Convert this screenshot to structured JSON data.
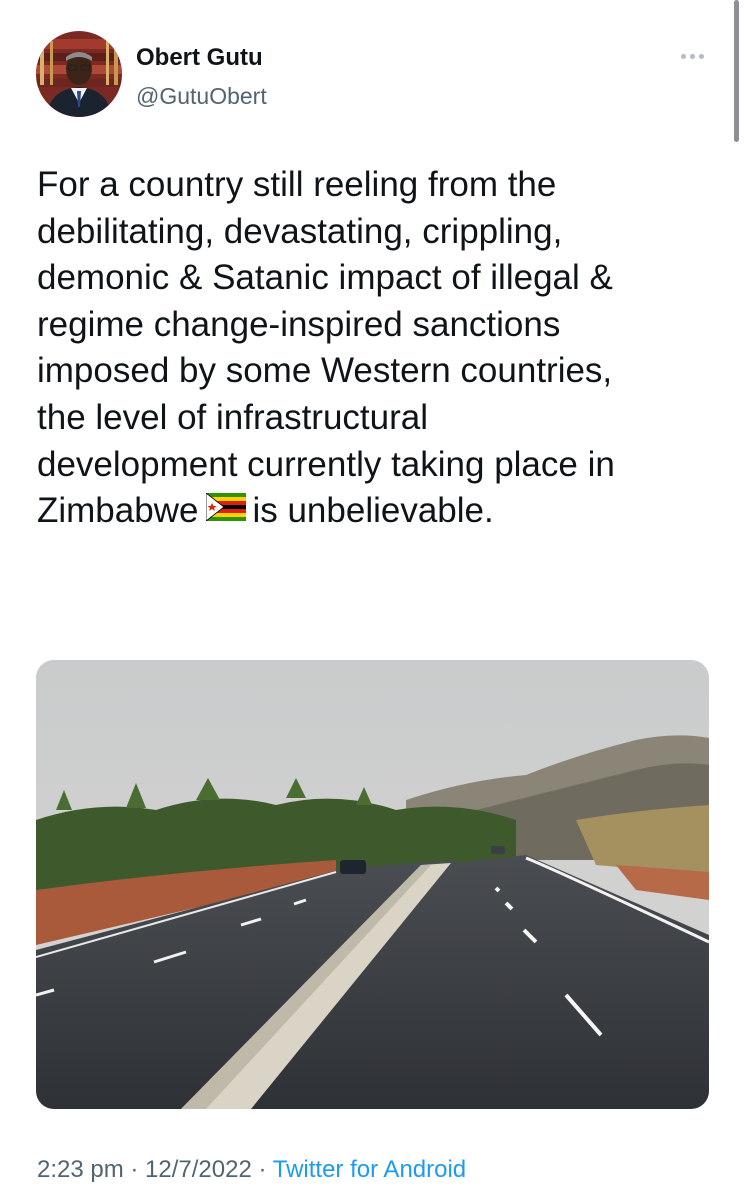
{
  "author": {
    "name": "Obert Gutu",
    "handle": "@GutuObert"
  },
  "tweet": {
    "lines": [
      "For a country still reeling from the",
      "debilitating, devastating, crippling,",
      "demonic & Satanic impact of illegal &",
      "regime change-inspired sanctions",
      "imposed by some Western countries,",
      "the level of infrastructural",
      "development currently taking place in",
      "Zimbabwe",
      "is unbelievable."
    ]
  },
  "meta": {
    "time": "2:23 pm",
    "sep1": " · ",
    "date": "12/7/2022",
    "sep2": " · ",
    "source": "Twitter for Android"
  },
  "icons": {
    "more": "more-horizontal-icon",
    "flag": "zimbabwe-flag-emoji"
  },
  "colors": {
    "text": "#0f1419",
    "secondary": "#536471",
    "link": "#1d9bf0"
  }
}
